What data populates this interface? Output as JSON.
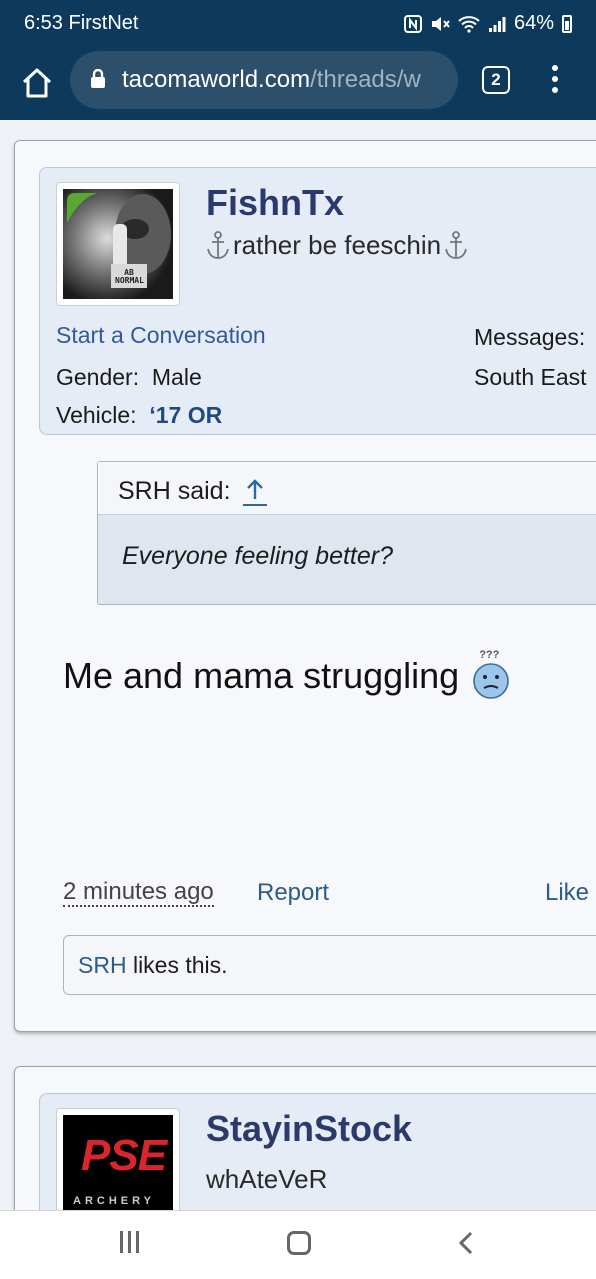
{
  "status_bar": {
    "time_carrier": "6:53 FirstNet",
    "battery": "64%"
  },
  "browser": {
    "url_host": "tacomaworld.com",
    "url_path": "/threads/w",
    "tab_count": "2"
  },
  "posts": [
    {
      "username": "FishnTx",
      "user_title": "rather be feeschin",
      "start_conversation": "Start a Conversation",
      "gender_label": "Gender:",
      "gender_value": "Male",
      "vehicle_label": "Vehicle:",
      "vehicle_value": "‘17 OR",
      "messages_label": "Messages:",
      "location": "South East",
      "avatar_sign_text": "AB NORMAL",
      "quote_author": "SRH said:",
      "quote_text": "Everyone feeling better?",
      "message": "Me and mama struggling",
      "emoji_marks": "???",
      "time": "2 minutes ago",
      "report": "Report",
      "like": "Like",
      "likes_user": "SRH",
      "likes_text": " likes this."
    },
    {
      "username": "StayinStock",
      "user_title": "whAteVeR",
      "avatar_logo_text": "PSE",
      "avatar_logo_sub": "ARCHERY"
    }
  ]
}
